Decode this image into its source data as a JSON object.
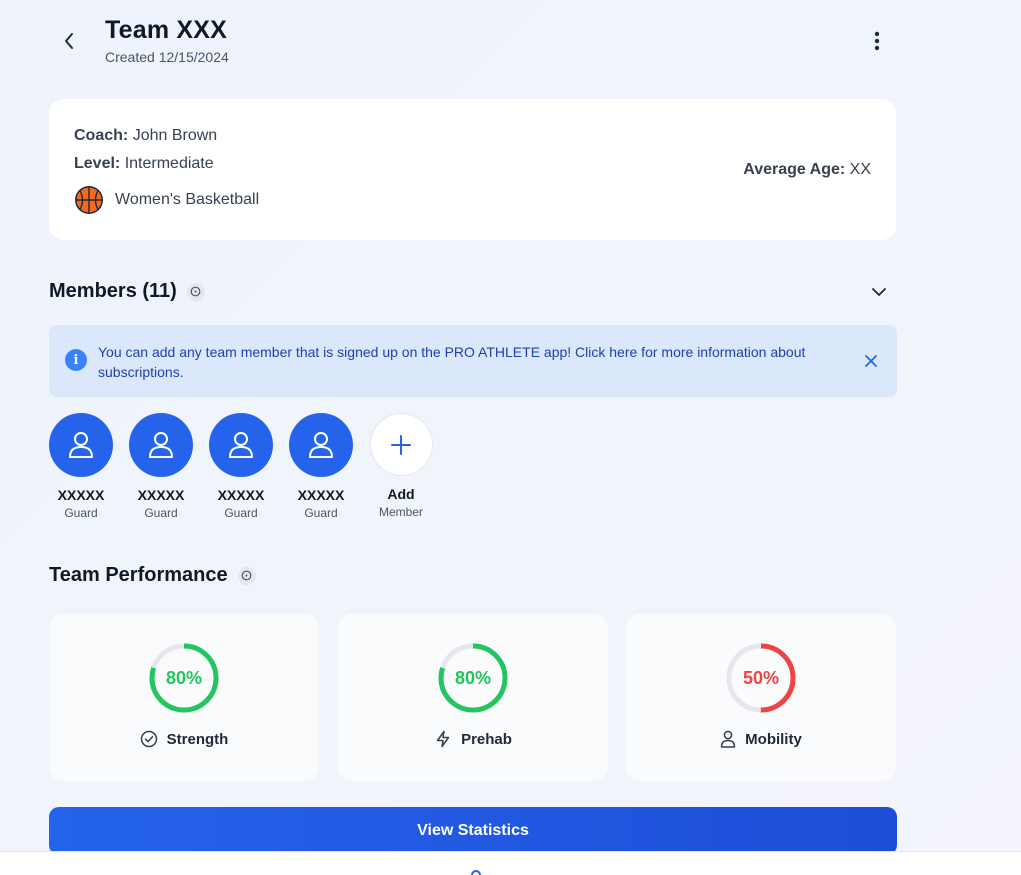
{
  "header": {
    "title": "Team XXX",
    "created": "Created 12/15/2024"
  },
  "info": {
    "coach_label": "Coach:",
    "coach": "John Brown",
    "level_label": "Level:",
    "level": "Intermediate",
    "sport": "Women's Basketball",
    "sport_icon": "basketball-icon",
    "avg_age_label": "Average Age:",
    "avg_age": "XX"
  },
  "members": {
    "title": "Members (11)",
    "banner": "You can add any team member that is signed up on the PRO ATHLETE app! Click here for more information about subscriptions.",
    "list": [
      {
        "name": "XXXXX",
        "role": "Guard"
      },
      {
        "name": "XXXXX",
        "role": "Guard"
      },
      {
        "name": "XXXXX",
        "role": "Guard"
      },
      {
        "name": "XXXXX",
        "role": "Guard"
      }
    ],
    "add_label": "Add",
    "add_sub": "Member"
  },
  "performance": {
    "title": "Team Performance",
    "cards": [
      {
        "label": "Strength",
        "value": 80,
        "display": "80%",
        "color": "#22c55e",
        "icon": "check-circle-icon"
      },
      {
        "label": "Prehab",
        "value": 80,
        "display": "80%",
        "color": "#22c55e",
        "icon": "lightning-icon"
      },
      {
        "label": "Mobility",
        "value": 50,
        "display": "50%",
        "color": "#ef4444",
        "icon": "person-icon"
      }
    ]
  },
  "actions": {
    "view_statistics": "View Statistics"
  },
  "colors": {
    "primary": "#2563eb",
    "banner_bg": "#dbe8fb",
    "good": "#22c55e",
    "bad": "#ef4444"
  }
}
